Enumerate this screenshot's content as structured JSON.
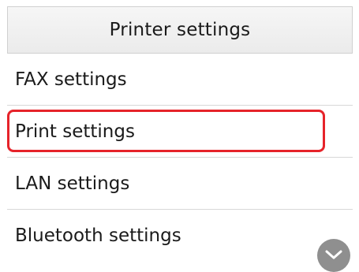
{
  "header": {
    "title": "Printer settings"
  },
  "menu": {
    "items": [
      {
        "label": "FAX settings"
      },
      {
        "label": "Print settings",
        "selected": true
      },
      {
        "label": "LAN settings"
      },
      {
        "label": "Bluetooth settings"
      }
    ]
  },
  "highlight_color": "#e6232a",
  "scroll_button": {
    "icon": "chevron-down-icon"
  }
}
